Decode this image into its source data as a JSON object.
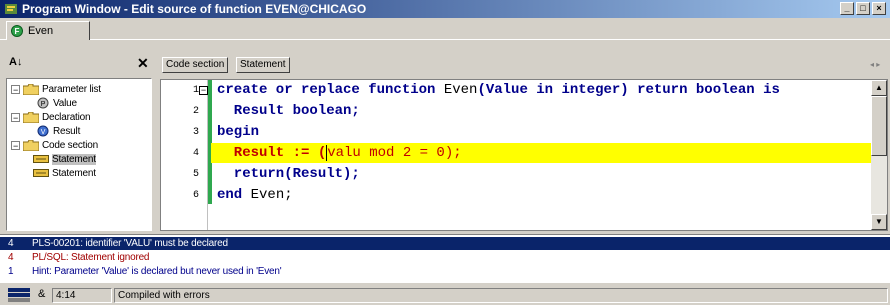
{
  "window": {
    "title": "Program Window - Edit source of function EVEN@CHICAGO"
  },
  "tabs": [
    {
      "label": "Even"
    }
  ],
  "tree": {
    "items": [
      {
        "label": "Parameter list",
        "icon": "folder-icon"
      },
      {
        "label": "Value",
        "icon": "parameter-icon"
      },
      {
        "label": "Declaration",
        "icon": "folder-icon"
      },
      {
        "label": "Result",
        "icon": "variable-icon"
      },
      {
        "label": "Code section",
        "icon": "folder-icon"
      },
      {
        "label": "Statement",
        "icon": "statement-icon"
      },
      {
        "label": "Statement",
        "icon": "statement-icon"
      }
    ]
  },
  "breadcrumb": [
    "Code section",
    "Statement"
  ],
  "editor": {
    "lines": [
      {
        "num": "1"
      },
      {
        "num": "2"
      },
      {
        "num": "3"
      },
      {
        "num": "4"
      },
      {
        "num": "5"
      },
      {
        "num": "6"
      }
    ],
    "code": {
      "l1_kw1": "create or replace function",
      "l1_name": " Even",
      "l1_kw2": "(Value in integer) return boolean is",
      "l2_kw": "  Result boolean;",
      "l3_kw": "begin",
      "l4_a": "  Result := (",
      "l4_b": "valu mod 2 = 0);",
      "l5_kw": "  return(Result);",
      "l6_kw": "end",
      "l6_name": " Even;"
    }
  },
  "messages": [
    {
      "num": "4",
      "text": "PLS-00201: identifier 'VALU' must be declared"
    },
    {
      "num": "4",
      "text": "PL/SQL: Statement ignored"
    },
    {
      "num": "1",
      "text": "Hint: Parameter 'Value' is declared but never used in 'Even'"
    }
  ],
  "status": {
    "ampersand": "&",
    "position": "4:14",
    "text": "Compiled with errors"
  },
  "colors": {
    "title_bar": "#0a246a",
    "highlight_line": "#ffff00",
    "error_text": "#c00000",
    "keyword": "#00008b"
  }
}
